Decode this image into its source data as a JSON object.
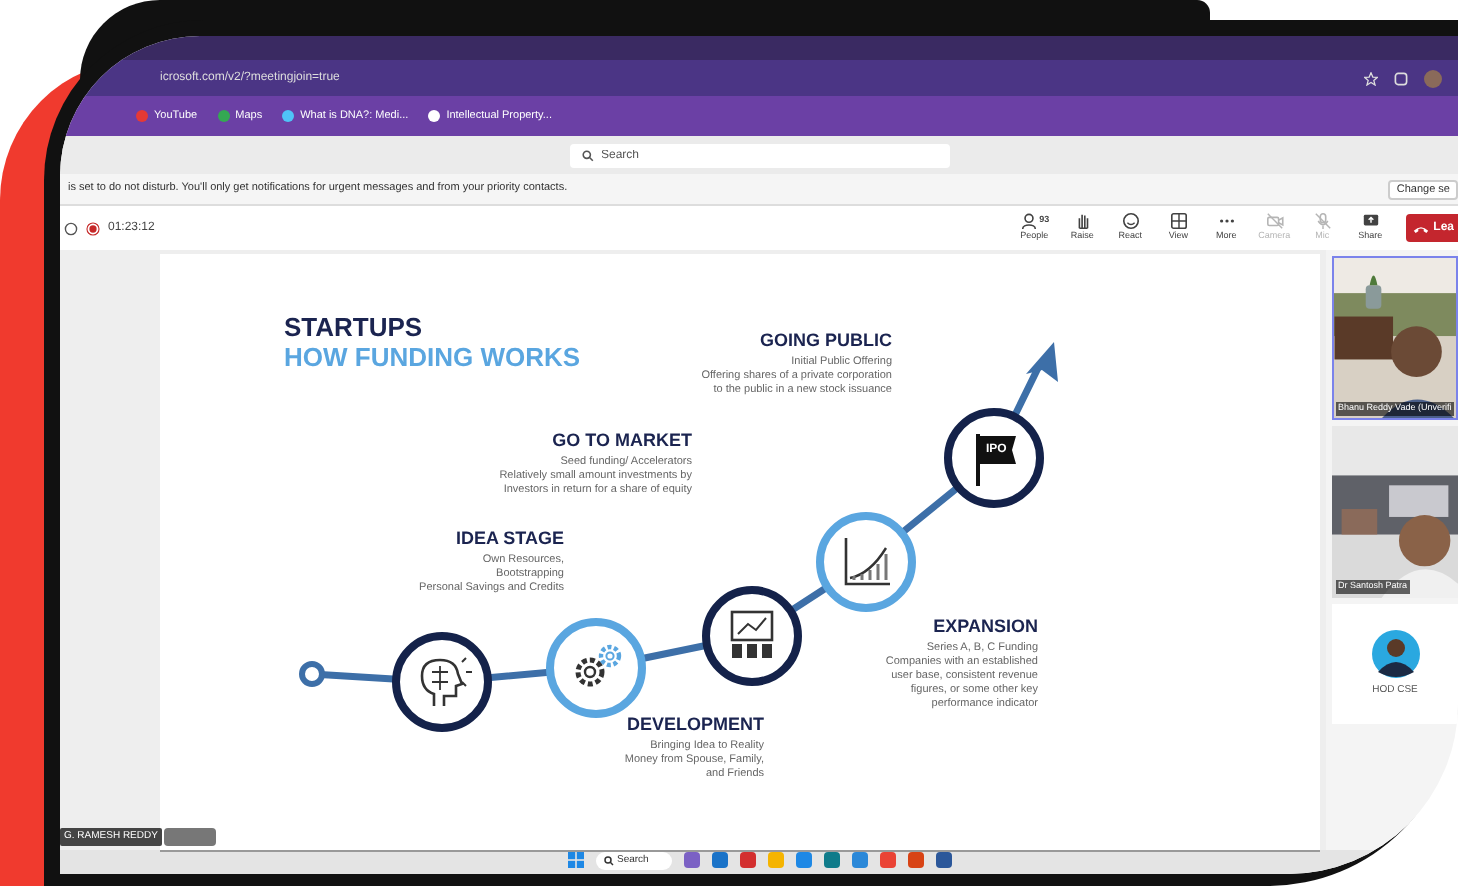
{
  "browser": {
    "url": "icrosoft.com/v2/?meetingjoin=true",
    "bookmarks": [
      {
        "label": "YouTube",
        "color": "#e53935"
      },
      {
        "label": "Maps",
        "color": "#34a853"
      },
      {
        "label": "What is DNA?: Medi...",
        "color": "#4fc3f7"
      },
      {
        "label": "Intellectual Property...",
        "color": "#ffffff"
      }
    ]
  },
  "teams": {
    "search_placeholder": "Search",
    "notification": "is set to do not disturb. You'll only get notifications for urgent messages and from your priority contacts.",
    "notification_button": "Change se",
    "recording": true,
    "timer": "01:23:12",
    "toolbar": [
      {
        "kind": "people",
        "label": "People",
        "badge": "93",
        "disabled": false
      },
      {
        "kind": "raise",
        "label": "Raise",
        "disabled": false
      },
      {
        "kind": "react",
        "label": "React",
        "disabled": false
      },
      {
        "kind": "view",
        "label": "View",
        "disabled": false
      },
      {
        "kind": "more",
        "label": "More",
        "disabled": false
      },
      {
        "kind": "camera",
        "label": "Camera",
        "disabled": true
      },
      {
        "kind": "mic",
        "label": "Mic",
        "disabled": true
      },
      {
        "kind": "share",
        "label": "Share",
        "disabled": false
      },
      {
        "kind": "leave",
        "label": "Lea",
        "disabled": false
      }
    ]
  },
  "slide": {
    "title": "STARTUPS",
    "subtitle": "HOW FUNDING WORKS",
    "stages": [
      {
        "kind": "idea",
        "heading": "IDEA STAGE",
        "text": "Own Resources,\nBootstrapping\nPersonal Savings and Credits",
        "color": "#14224a"
      },
      {
        "kind": "development",
        "heading": "DEVELOPMENT",
        "text": "Bringing Idea to Reality\nMoney from Spouse, Family,\nand Friends",
        "color": "#5aa6e0"
      },
      {
        "kind": "market",
        "heading": "GO TO MARKET",
        "text": "Seed funding/ Accelerators\nRelatively small amount investments by\nInvestors in return for a share of equity",
        "color": "#14224a"
      },
      {
        "kind": "expansion",
        "heading": "EXPANSION",
        "text": "Series A, B, C Funding\nCompanies with an established\nuser base, consistent revenue\nfigures, or some other key\nperformance indicator",
        "color": "#5aa6e0"
      },
      {
        "kind": "ipo",
        "heading": "GOING PUBLIC",
        "text": "Initial Public Offering\nOffering shares of a private corporation\nto the public in a new stock issuance",
        "color": "#14224a",
        "badge": "IPO"
      }
    ]
  },
  "participants": [
    {
      "kind": "video",
      "name": "Bhanu Reddy Vade (Unverifi"
    },
    {
      "kind": "video",
      "name": "Dr Santosh Patra"
    },
    {
      "kind": "avatar",
      "name": "HOD CSE"
    }
  ],
  "presenter_tag": "G. RAMESH REDDY",
  "taskbar": {
    "search": "Search"
  }
}
